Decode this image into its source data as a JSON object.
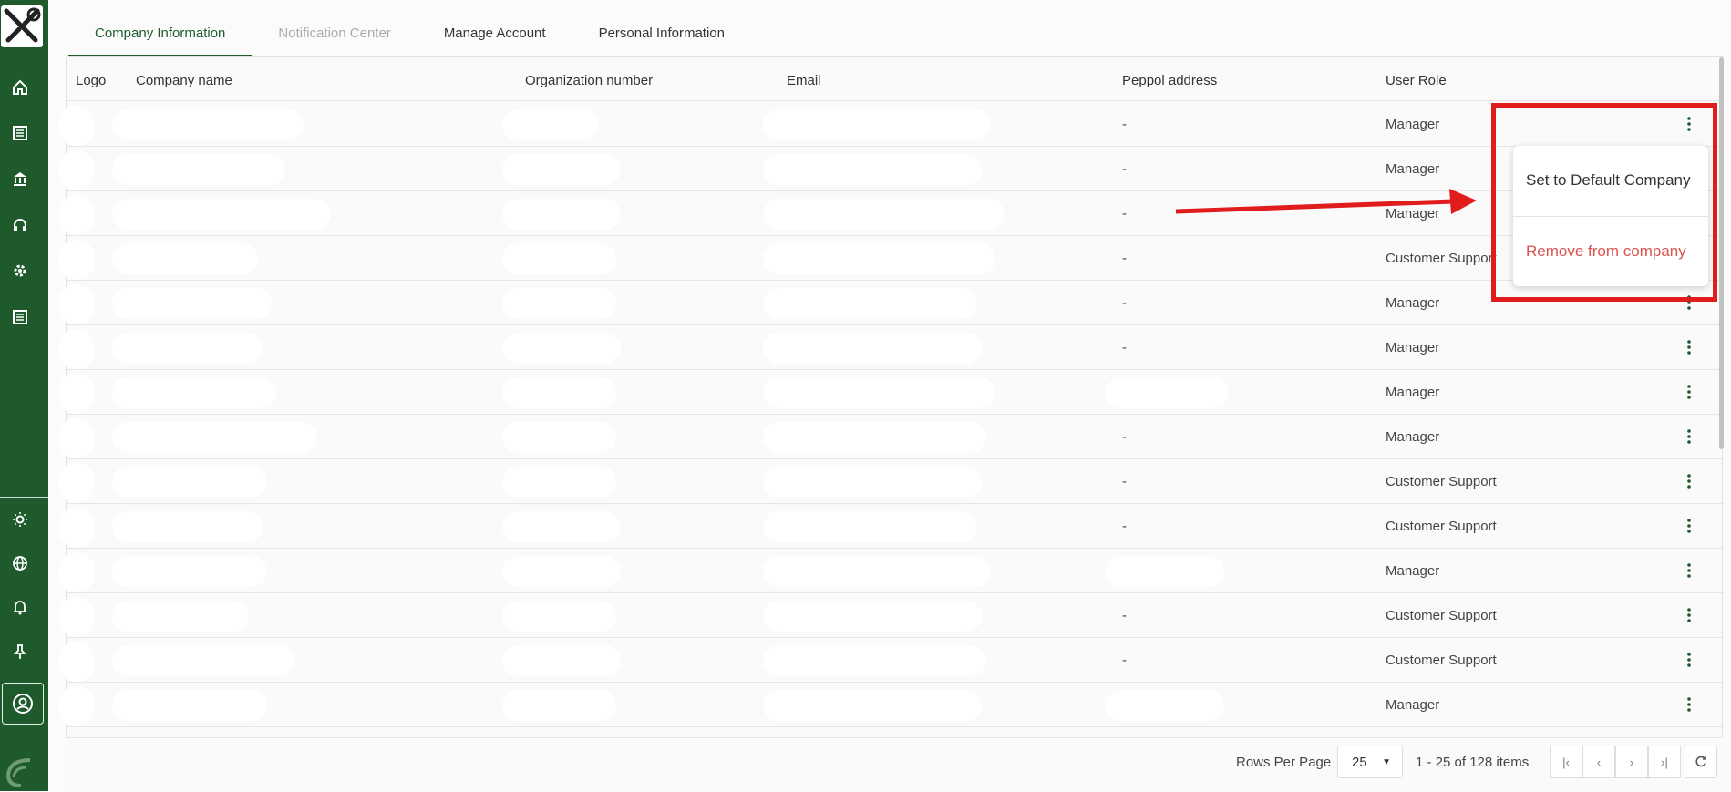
{
  "tabs": [
    {
      "label": "Company Information"
    },
    {
      "label": "Notification Center"
    },
    {
      "label": "Manage Account"
    },
    {
      "label": "Personal Information"
    }
  ],
  "table": {
    "columns": [
      "Logo",
      "Company name",
      "Organization number",
      "Email",
      "Peppol address",
      "User Role"
    ],
    "rows": [
      {
        "peppol": "-",
        "role": "Manager"
      },
      {
        "peppol": "-",
        "role": "Manager"
      },
      {
        "peppol": "-",
        "role": "Manager"
      },
      {
        "peppol": "-",
        "role": "Customer Support"
      },
      {
        "peppol": "-",
        "role": "Manager"
      },
      {
        "peppol": "-",
        "role": "Manager"
      },
      {
        "peppol": "",
        "role": "Manager"
      },
      {
        "peppol": "-",
        "role": "Manager"
      },
      {
        "peppol": "-",
        "role": "Customer Support"
      },
      {
        "peppol": "-",
        "role": "Customer Support"
      },
      {
        "peppol": "",
        "role": "Manager"
      },
      {
        "peppol": "-",
        "role": "Customer Support"
      },
      {
        "peppol": "-",
        "role": "Customer Support"
      },
      {
        "peppol": "",
        "role": "Manager"
      }
    ]
  },
  "context_menu": {
    "set_default": "Set to Default Company",
    "remove": "Remove from company"
  },
  "footer": {
    "rows_per_page_label": "Rows Per Page",
    "rows_per_page_value": "25",
    "range_label": "1 - 25 of 128 items"
  },
  "sidebar": {
    "icons": [
      "home-icon",
      "list-icon",
      "bank-icon",
      "headset-icon",
      "gear-icon",
      "document-icon",
      "sun-icon",
      "globe-icon",
      "bell-icon",
      "pin-icon",
      "account-icon"
    ]
  },
  "colors": {
    "brand_green": "#1e5a2c",
    "annotation_red": "#e01c1c",
    "danger_text": "#d9534f"
  }
}
